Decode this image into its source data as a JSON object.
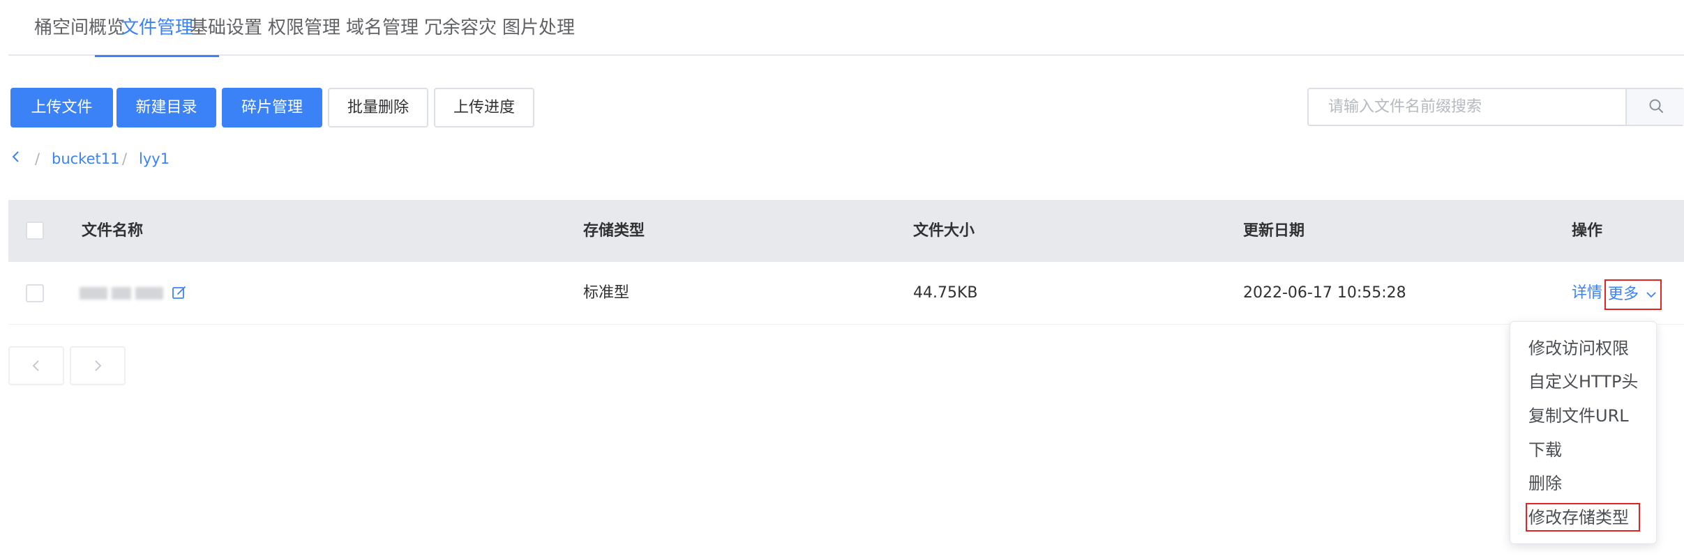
{
  "tabs": [
    {
      "label": "桶空间概览",
      "active": false
    },
    {
      "label": "文件管理",
      "active": true
    },
    {
      "label": "基础设置",
      "active": false
    },
    {
      "label": "权限管理",
      "active": false
    },
    {
      "label": "域名管理",
      "active": false
    },
    {
      "label": "冗余容灾",
      "active": false
    },
    {
      "label": "图片处理",
      "active": false
    }
  ],
  "toolbar": {
    "upload_file": "上传文件",
    "new_folder": "新建目录",
    "fragment_manage": "碎片管理",
    "batch_delete": "批量删除",
    "upload_progress": "上传进度"
  },
  "search": {
    "placeholder": "请输入文件名前缀搜索",
    "value": ""
  },
  "breadcrumb": {
    "separator": "/",
    "items": [
      "bucket11",
      "lyy1"
    ]
  },
  "table": {
    "headers": {
      "name": "文件名称",
      "storage_type": "存储类型",
      "size": "文件大小",
      "updated": "更新日期",
      "actions": "操作"
    },
    "rows": [
      {
        "name": "",
        "storage_type": "标准型",
        "size": "44.75KB",
        "updated": "2022-06-17 10:55:28",
        "detail_label": "详情",
        "more_label": "更多"
      }
    ]
  },
  "more_menu": {
    "items": [
      "修改访问权限",
      "自定义HTTP头",
      "复制文件URL",
      "下载",
      "删除",
      "修改存储类型"
    ],
    "highlighted": "修改存储类型"
  },
  "colors": {
    "accent": "#3b82f6",
    "highlight_border": "#e02424",
    "table_header_bg": "#e8e9ec"
  },
  "icons": [
    "search-icon",
    "chevron-left-icon",
    "edit-icon",
    "chevron-down-icon",
    "chevron-right-icon"
  ]
}
